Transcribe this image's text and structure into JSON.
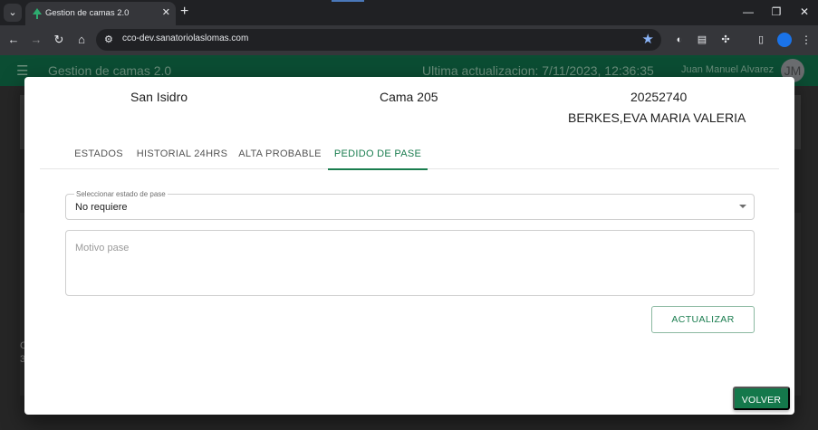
{
  "browser": {
    "tab_title": "Gestion de camas 2.0",
    "tab_close": "✕",
    "new_tab": "+",
    "url": "cco-dev.sanatoriolaslomas.com",
    "window_controls": [
      "—",
      "❐",
      "✕"
    ]
  },
  "app": {
    "title": "Gestion de camas 2.0",
    "last_update": "Ultima actualizacion: 7/11/2023, 12:36:35",
    "user_name": "Juan Manuel Alvarez",
    "avatar_initials": "JM",
    "background_text": [
      "C",
      "3"
    ]
  },
  "dialog": {
    "sede": "San Isidro",
    "cama": "Cama 205",
    "patient_id": "20252740",
    "patient_name": "BERKES,EVA MARIA VALERIA",
    "tabs": [
      {
        "label": "ESTADOS",
        "active": false
      },
      {
        "label": "HISTORIAL 24HRS",
        "active": false
      },
      {
        "label": "ALTA PROBABLE",
        "active": false
      },
      {
        "label": "PEDIDO DE PASE",
        "active": true
      }
    ],
    "pase_select": {
      "label": "Seleccionar estado de pase",
      "value": "No requiere"
    },
    "motivo": {
      "placeholder": "Motivo pase",
      "value": ""
    },
    "update_button": "ACTUALIZAR",
    "back_button": "VOLVER"
  },
  "colors": {
    "accent": "#14784b",
    "appbar": "#0b4d33",
    "browser_bg": "#202124"
  }
}
